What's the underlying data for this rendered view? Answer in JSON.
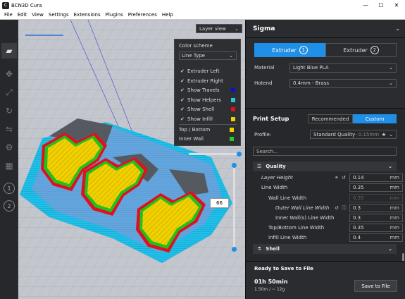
{
  "window": {
    "title": "BCN3D Cura",
    "logo_text": "C",
    "min": "—",
    "max": "☐",
    "close": "✕"
  },
  "menu": [
    "File",
    "Edit",
    "View",
    "Settings",
    "Extensions",
    "Plugins",
    "Preferences",
    "Help"
  ],
  "viewport": {
    "view_mode": "Layer view",
    "color_scheme_label": "Color scheme",
    "color_scheme_value": "Line Type",
    "legend": [
      {
        "label": "Extruder Left",
        "checked": true,
        "color": ""
      },
      {
        "label": "Extruder Right",
        "checked": true,
        "color": ""
      },
      {
        "label": "Show Travels",
        "checked": true,
        "color": "#1010c8"
      },
      {
        "label": "Show Helpers",
        "checked": true,
        "color": "#20c8e0"
      },
      {
        "label": "Show Shell",
        "checked": true,
        "color": "#e01020"
      },
      {
        "label": "Show Infill",
        "checked": true,
        "color": "#f0d000"
      }
    ],
    "legend_extra": [
      {
        "label": "Top / Bottom",
        "color": "#f0d000"
      },
      {
        "label": "Inner Wall",
        "color": "#20d020"
      }
    ],
    "layer_number": "66",
    "tool_icons": [
      "open-folder-icon",
      "move-icon",
      "scale-icon",
      "rotate-icon",
      "mirror-icon",
      "per-model-settings-icon",
      "support-blocker-icon"
    ],
    "extruder_buttons": [
      "1",
      "2"
    ]
  },
  "sidebar": {
    "printer_name": "Sigma",
    "extruder_tabs": [
      {
        "label": "Extruder",
        "num": "1"
      },
      {
        "label": "Extruder",
        "num": "2"
      }
    ],
    "material_label": "Material",
    "material_value": "Light Blue PLA",
    "hotend_label": "Hotend",
    "hotend_value": "0.4mm - Brass",
    "print_setup": {
      "title": "Print Setup",
      "recommended": "Recommended",
      "custom": "Custom",
      "profile_label": "Profile:",
      "profile_value": "Standard Quality",
      "profile_suffix": " - 0.15mm",
      "search_placeholder": "Search...",
      "section_quality": "Quality",
      "settings": [
        {
          "label": "Layer Height",
          "value": "0.14",
          "unit": "mm"
        },
        {
          "label": "Line Width",
          "value": "0.35",
          "unit": "mm"
        },
        {
          "label": "Wall Line Width",
          "value": "0.35",
          "unit": "mm"
        },
        {
          "label": "Outer Wall Line Width",
          "value": "0.3",
          "unit": "mm"
        },
        {
          "label": "Inner Wall(s) Line Width",
          "value": "0.3",
          "unit": "mm"
        },
        {
          "label": "Top/Bottom Line Width",
          "value": "0.35",
          "unit": "mm"
        },
        {
          "label": "Infill Line Width",
          "value": "0.4",
          "unit": "mm"
        }
      ],
      "section_shell": "Shell"
    },
    "footer": {
      "status": "Ready to Save to File",
      "time": "01h 50min",
      "material_usage": "1.50m / ~ 12g",
      "save_button": "Save to File"
    }
  }
}
